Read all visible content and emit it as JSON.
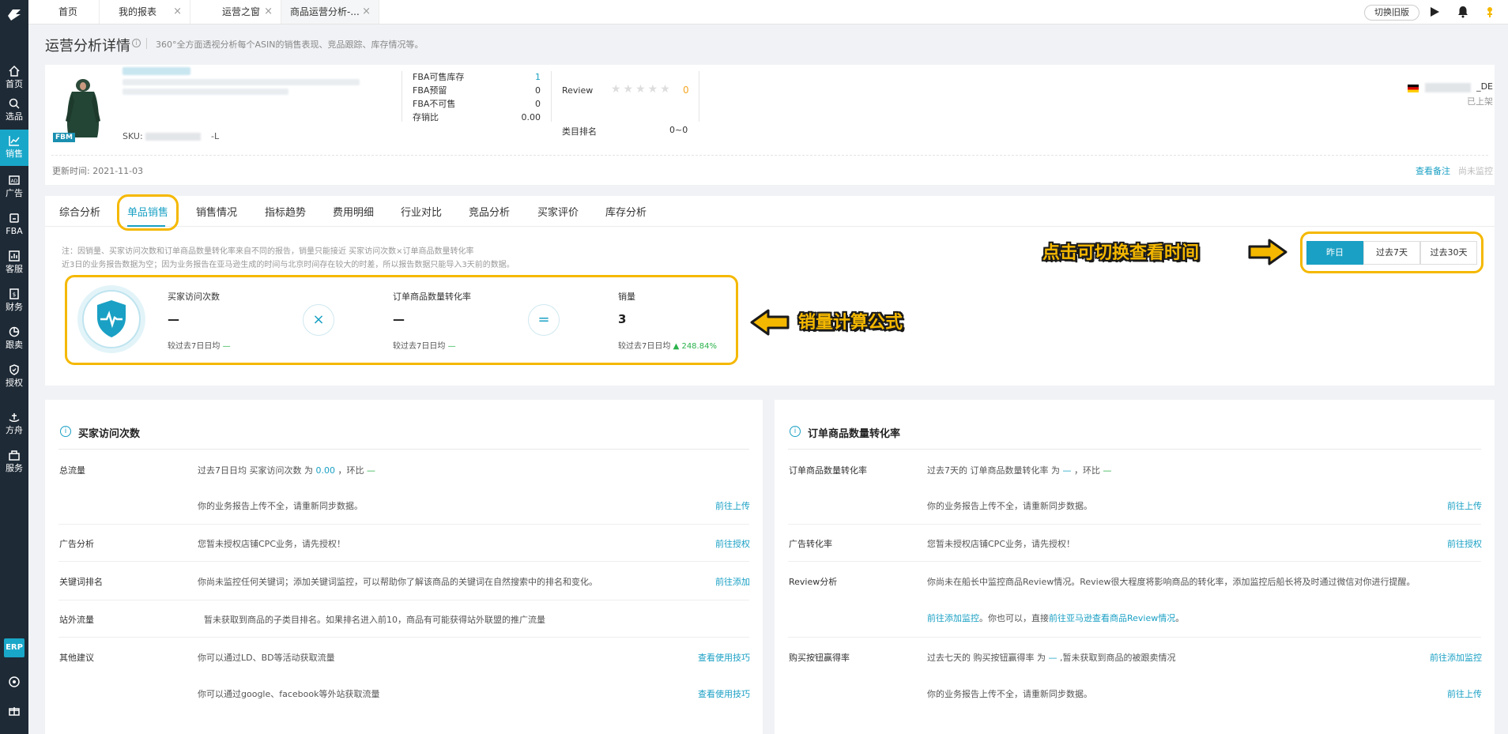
{
  "sidebar": {
    "items": [
      {
        "label": "首页",
        "icon": "home-icon"
      },
      {
        "label": "选品",
        "icon": "search-icon"
      },
      {
        "label": "销售",
        "icon": "chart-line-icon"
      },
      {
        "label": "广告",
        "icon": "ad-icon"
      },
      {
        "label": "FBA",
        "icon": "box-icon"
      },
      {
        "label": "客服",
        "icon": "bar-chart-icon"
      },
      {
        "label": "财务",
        "icon": "finance-icon"
      },
      {
        "label": "跟卖",
        "icon": "pie-chart-icon"
      },
      {
        "label": "授权",
        "icon": "shield-icon"
      },
      {
        "label": "方舟",
        "icon": "ark-icon"
      },
      {
        "label": "服务",
        "icon": "service-icon"
      }
    ],
    "erp_label": "ERP"
  },
  "tabs": [
    {
      "label": "首页"
    },
    {
      "label": "我的报表"
    },
    {
      "label": "运营之窗"
    },
    {
      "label": "商品运营分析-..."
    }
  ],
  "topbar": {
    "switch_old": "切换旧版"
  },
  "header": {
    "title": "运营分析详情",
    "subtitle": "360°全方面透视分析每个ASIN的销售表现、竞品跟踪、库存情况等。"
  },
  "product": {
    "fbm_badge": "FBM",
    "sku_label": "SKU:",
    "sku_suffix": "-L",
    "stats": [
      {
        "label": "FBA可售库存",
        "value": "1",
        "color": "#1aa0c4"
      },
      {
        "label": "FBA预留",
        "value": "0",
        "color": "#333"
      },
      {
        "label": "FBA不可售",
        "value": "0",
        "color": "#333"
      },
      {
        "label": "存销比",
        "value": "0.00",
        "color": "#333"
      }
    ],
    "review_label": "Review",
    "review_stars": "★★★★★",
    "review_value": "0",
    "category_rank_label": "类目排名",
    "category_rank_value": "0~0",
    "store_suffix": "_DE",
    "status": "已上架",
    "update_time": "更新时间:   2021-11-03",
    "view_note": "查看备注",
    "not_monitored": "尚未监控"
  },
  "analysis_tabs": [
    {
      "label": "综合分析"
    },
    {
      "label": "单品销售"
    },
    {
      "label": "销售情况"
    },
    {
      "label": "指标趋势"
    },
    {
      "label": "费用明细"
    },
    {
      "label": "行业对比"
    },
    {
      "label": "竞品分析"
    },
    {
      "label": "买家评价"
    },
    {
      "label": "库存分析"
    }
  ],
  "notes": {
    "line1": "注：因销量、买家访问次数和订单商品数量转化率来自不同的报告，销量只能接近 买家访问次数×订单商品数量转化率",
    "line2": "近3日的业务报告数据为空；因为业务报告在亚马逊生成的时间与北京时间存在较大的时差，所以报告数据只能导入3天前的数据。"
  },
  "period": {
    "options": [
      "昨日",
      "过去7天",
      "过去30天"
    ],
    "selected": "昨日"
  },
  "formula": {
    "visits": {
      "label": "买家访问次数",
      "value": "—",
      "compare": "较过去7日日均",
      "delta": "—"
    },
    "op_multiply": "×",
    "conversion": {
      "label": "订单商品数量转化率",
      "value": "—",
      "compare": "较过去7日日均",
      "delta": "—"
    },
    "op_equals": "=",
    "sales": {
      "label": "销量",
      "value": "3",
      "compare": "较过去7日日均",
      "delta": "248.84%"
    }
  },
  "annotations": {
    "switch": "点击可切换查看时间",
    "formula": "销量计算公式"
  },
  "left_panel": {
    "title": "买家访问次数",
    "rows": [
      {
        "label": "总流量",
        "text_pre": "过去7日日均 买家访问次数 为",
        "value": "0.00",
        "text_mid": "，环比",
        "delta": "—"
      },
      {
        "text": "你的业务报告上传不全，请重新同步数据。",
        "link": "前往上传"
      },
      {
        "label": "广告分析",
        "text": "您暂未授权店铺CPC业务，请先授权！",
        "link": "前往授权"
      },
      {
        "label": "关键词排名",
        "text": "你尚未监控任何关键词；添加关键词监控，可以帮助你了解该商品的关键词在自然搜索中的排名和变化。",
        "link": "前往添加"
      },
      {
        "label": "站外流量",
        "text": "暂未获取到商品的子类目排名。如果排名进入前10，商品有可能获得站外联盟的推广流量"
      },
      {
        "label": "其他建议",
        "text": "你可以通过LD、BD等活动获取流量",
        "link": "查看使用技巧"
      },
      {
        "text": "你可以通过google、facebook等外站获取流量",
        "link": "查看使用技巧"
      }
    ]
  },
  "right_panel": {
    "title": "订单商品数量转化率",
    "rows": [
      {
        "label": "订单商品数量转化率",
        "text_pre": "过去7天的 订单商品数量转化率 为",
        "value": "—",
        "text_mid": "，环比",
        "delta": "—"
      },
      {
        "text": "你的业务报告上传不全，请重新同步数据。",
        "link": "前往上传"
      },
      {
        "label": "广告转化率",
        "text": "您暂未授权店铺CPC业务，请先授权！",
        "link": "前往授权"
      },
      {
        "label": "Review分析",
        "text": "你尚未在船长中监控商品Review情况。Review很大程度将影响商品的转化率，添加监控后船长将及时通过微信对你进行提醒。"
      },
      {
        "link_a": "前往添加监控",
        "text_mid": "。你也可以，直接",
        "link_b": "前往亚马逊查看商品Review情况",
        "text_end": "。"
      },
      {
        "label": "购买按钮赢得率",
        "text_pre": "过去七天的 购买按钮赢得率 为",
        "value": "—",
        "text_post": ",暂未获取到商品的被跟卖情况",
        "link": "前往添加监控"
      },
      {
        "text": "你的业务报告上传不全，请重新同步数据。",
        "link": "前往上传"
      }
    ]
  }
}
